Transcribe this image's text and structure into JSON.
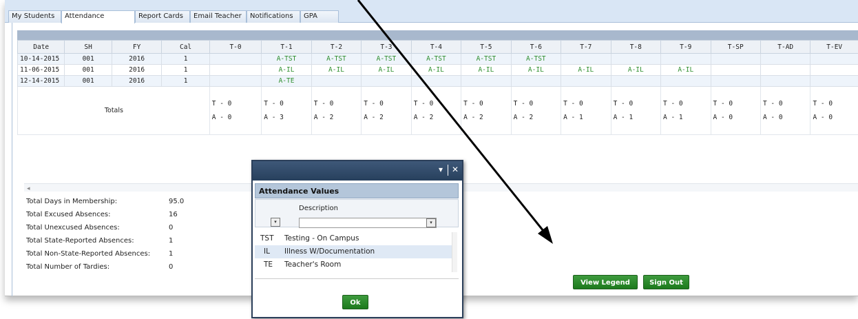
{
  "tabs": [
    "My Students",
    "Attendance",
    "Report Cards",
    "Email Teacher",
    "Notifications",
    "GPA"
  ],
  "active_tab": "Attendance",
  "grid": {
    "columns": [
      "Date",
      "SH",
      "FY",
      "Cal",
      "T-0",
      "T-1",
      "T-2",
      "T-3",
      "T-4",
      "T-5",
      "T-6",
      "T-7",
      "T-8",
      "T-9",
      "T-SP",
      "T-AD",
      "T-EV"
    ],
    "rows": [
      [
        "10-14-2015",
        "001",
        "2016",
        "1",
        "",
        "A-TST",
        "A-TST",
        "A-TST",
        "A-TST",
        "A-TST",
        "A-TST",
        "",
        "",
        "",
        "",
        "",
        ""
      ],
      [
        "11-06-2015",
        "001",
        "2016",
        "1",
        "",
        "A-IL",
        "A-IL",
        "A-IL",
        "A-IL",
        "A-IL",
        "A-IL",
        "A-IL",
        "A-IL",
        "A-IL",
        "",
        "",
        ""
      ],
      [
        "12-14-2015",
        "001",
        "2016",
        "1",
        "",
        "A-TE",
        "",
        "",
        "",
        "",
        "",
        "",
        "",
        "",
        "",
        "",
        ""
      ]
    ],
    "totals_label": "Totals",
    "totals": [
      [
        "T - 0",
        "A - 0"
      ],
      [
        "T - 0",
        "A - 3"
      ],
      [
        "T - 0",
        "A - 2"
      ],
      [
        "T - 0",
        "A - 2"
      ],
      [
        "T - 0",
        "A - 2"
      ],
      [
        "T - 0",
        "A - 2"
      ],
      [
        "T - 0",
        "A - 2"
      ],
      [
        "T - 0",
        "A - 1"
      ],
      [
        "T - 0",
        "A - 1"
      ],
      [
        "T - 0",
        "A - 1"
      ],
      [
        "T - 0",
        "A - 0"
      ],
      [
        "T - 0",
        "A - 0"
      ],
      [
        "T - 0",
        "A - 0"
      ]
    ],
    "scroll_left_glyph": "◂"
  },
  "summary": [
    {
      "label": "Total Days in Membership:",
      "value": "95.0"
    },
    {
      "label": "Total Excused Absences:",
      "value": "16"
    },
    {
      "label": "Total Unexcused Absences:",
      "value": "0"
    },
    {
      "label": "Total State-Reported Absences:",
      "value": "1"
    },
    {
      "label": "Total Non-State-Reported Absences:",
      "value": "1"
    },
    {
      "label": "Total Number of Tardies:",
      "value": "0"
    }
  ],
  "buttons": {
    "view_legend": "View Legend",
    "sign_out": "Sign Out"
  },
  "dialog": {
    "title_controls": {
      "dropdown": "▾",
      "close": "✕"
    },
    "heading": "Attendance Values",
    "column_header": "Description",
    "filter_glyph": "▾",
    "items": [
      {
        "code": "TST",
        "description": "Testing - On Campus"
      },
      {
        "code": "IL",
        "description": "Illness W/Documentation"
      },
      {
        "code": "TE",
        "description": "Teacher's Room"
      }
    ],
    "selected_index": 1,
    "ok_label": "Ok"
  },
  "colors": {
    "accent_green": "#2f8f2f",
    "dialog_titlebar": "#27405d",
    "header_band": "#a8b8cd"
  }
}
